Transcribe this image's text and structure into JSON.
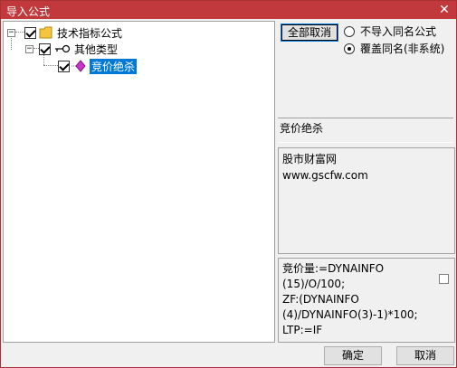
{
  "window": {
    "title": "导入公式",
    "close_label": "✕"
  },
  "tree": {
    "root": {
      "label": "技术指标公式",
      "expander": "−",
      "icon": "folder-icon"
    },
    "child": {
      "label": "其他类型",
      "expander": "−",
      "icon": "key-icon"
    },
    "leaf": {
      "label": "竞价绝杀",
      "icon": "diamond-icon"
    }
  },
  "options": {
    "cancel_all_label": "全部取消",
    "radio_no_import": "不导入同名公式",
    "radio_overwrite": "覆盖同名(非系统)",
    "selected": "overwrite"
  },
  "formula": {
    "name": "竞价绝杀",
    "description_lines": [
      "股市财富网",
      "www.gscfw.com"
    ],
    "code_lines": [
      "竞价量:=DYNAINFO",
      "(15)/O/100;",
      "ZF:(DYNAINFO",
      "(4)/DYNAINFO(3)-1)*100;",
      "LTP:=IF"
    ]
  },
  "footer": {
    "ok_label": "确定",
    "cancel_label": "取消"
  },
  "colors": {
    "titlebar": "#c1393c",
    "selection": "#0078d7",
    "folder": "#f5c542",
    "diamond": "#cc33cc"
  }
}
